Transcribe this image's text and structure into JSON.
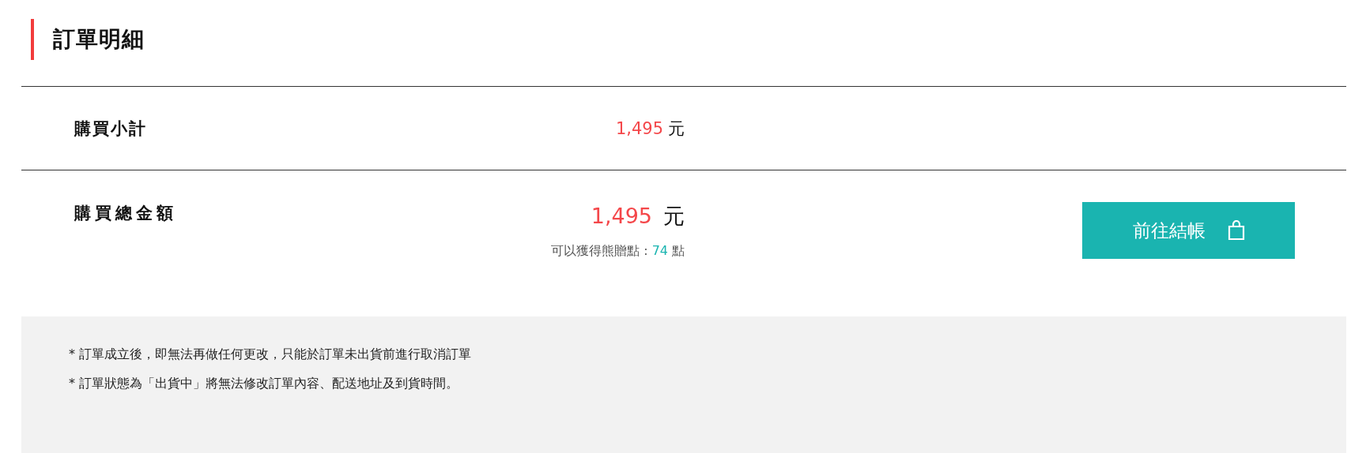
{
  "title": "訂單明細",
  "subtotal": {
    "label": "購買小計",
    "amount": "1,495",
    "currency": "元"
  },
  "total": {
    "label": "購買總金額",
    "amount": "1,495",
    "currency": "元",
    "points_label": "可以獲得熊贈點 :",
    "points": "74",
    "points_unit": "點"
  },
  "checkout_button": {
    "label": "前往結帳"
  },
  "notes": [
    "* 訂單成立後，即無法再做任何更改，只能於訂單未出貨前進行取消訂單",
    "* 訂單狀態為「出貨中」將無法修改訂單內容、配送地址及到貨時間。"
  ]
}
